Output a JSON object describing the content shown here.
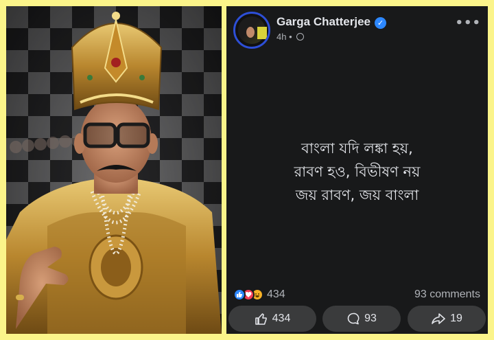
{
  "post": {
    "author": "Garga Chatterjee",
    "time": "4h",
    "separator": "•",
    "more": "•••",
    "verified_mark": "✓",
    "body_lines": [
      "বাংলা যদি লঙ্কা হয়,",
      "রাবণ হও, বিভীষণ নয়",
      "জয় রাবণ, জয় বাংলা"
    ],
    "reaction_count": "434",
    "comments_label": "93 comments",
    "actions": {
      "like_count": "434",
      "comment_count": "93",
      "share_count": "19"
    },
    "icons": {
      "like": "thumbs-up-icon",
      "comment": "speech-bubble-icon",
      "share": "share-arrow-icon",
      "privacy": "globe-icon",
      "verified": "verified-badge-icon"
    }
  },
  "colors": {
    "frame": "#fbf48a",
    "post_bg": "#18191a",
    "button_bg": "#3a3b3c",
    "verified": "#2d88ff",
    "avatar_ring": "#2d4fd7"
  }
}
